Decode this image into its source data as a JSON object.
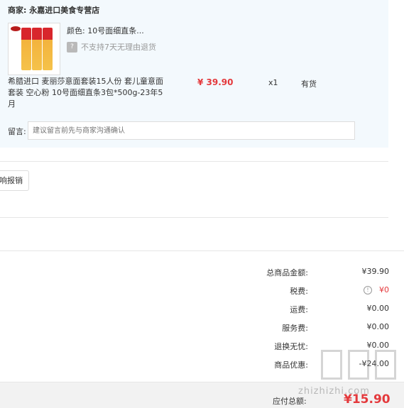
{
  "merchant": {
    "label": "商家:",
    "name": "永嘉进口美食专营店"
  },
  "product": {
    "image_icon": "product-image",
    "attr_label": "颜色:",
    "attr_value": "10号面细直条...",
    "return_policy": "不支持7天无理由退货",
    "return_icon": "question-icon",
    "title_line1": "希腊进口 麦丽莎意面套装15人份 套儿童意面",
    "title_line2": "套装 空心粉 10号面细直条3包*500g-23年5月",
    "price": "¥ 39.90",
    "quantity": "x1",
    "stock": "有货"
  },
  "remark": {
    "label": "留言:",
    "placeholder": "建议留言前先与商家沟通确认"
  },
  "invoice_button": "响报销",
  "summary": [
    {
      "label": "总商品金额:",
      "value": "¥39.90"
    },
    {
      "label": "税费:",
      "value": "¥0",
      "highlight": true,
      "icon": "info-icon"
    },
    {
      "label": "运费:",
      "value": "¥0.00"
    },
    {
      "label": "服务费:",
      "value": "¥0.00"
    },
    {
      "label": "退换无忧:",
      "value": "¥0.00"
    },
    {
      "label": "商品优惠:",
      "value": "-¥24.00"
    }
  ],
  "payable": {
    "label": "应付总额:",
    "value": "¥15.90"
  },
  "watermark": {
    "text": "zhizhizhi.com"
  },
  "colors": {
    "price_red": "#e4393c",
    "panel_bg": "#f3f9fd",
    "pay_bar_bg": "#f2f2f2"
  }
}
